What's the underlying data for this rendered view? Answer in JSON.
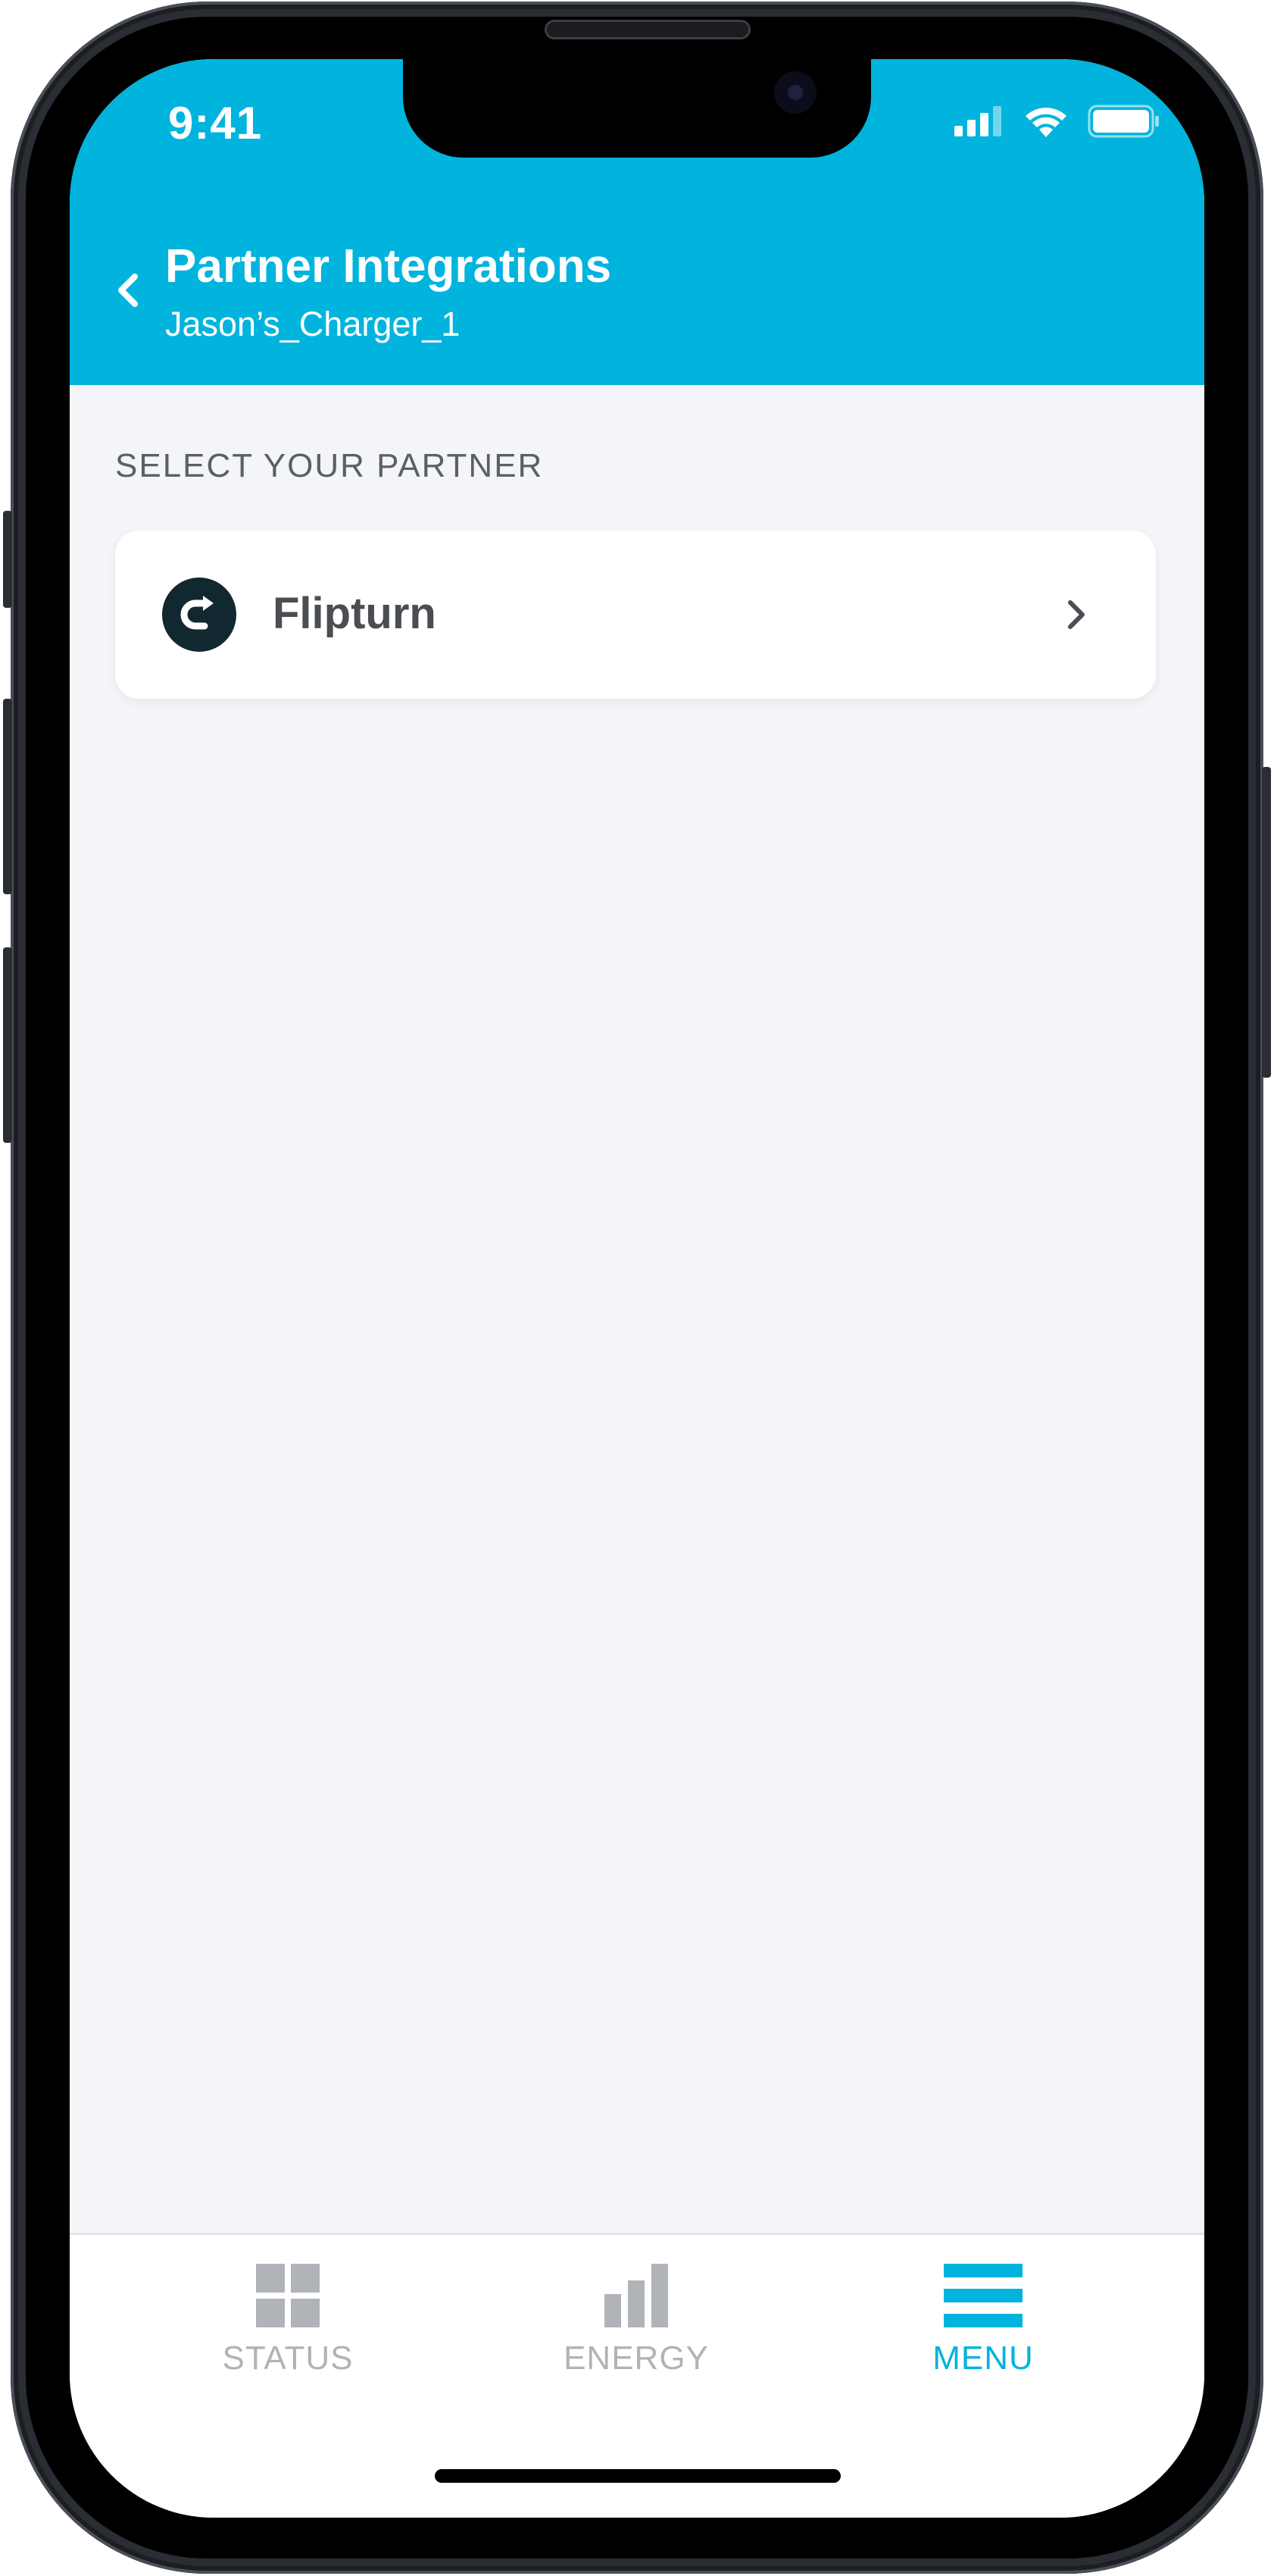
{
  "status_bar": {
    "time": "9:41"
  },
  "header": {
    "title": "Partner Integrations",
    "subtitle": "Jason’s_Charger_1"
  },
  "section": {
    "label": "SELECT YOUR PARTNER"
  },
  "partners": [
    {
      "name": "Flipturn",
      "icon": "flipturn-logo-icon"
    }
  ],
  "tabbar": {
    "tabs": [
      {
        "label": "STATUS",
        "icon": "grid-icon",
        "active": false
      },
      {
        "label": "ENERGY",
        "icon": "bar-chart-icon",
        "active": false
      },
      {
        "label": "MENU",
        "icon": "hamburger-menu-icon",
        "active": true
      }
    ]
  },
  "colors": {
    "brand": "#00b4dd",
    "background": "#f4f5f9",
    "tab_inactive": "#b0b3b8",
    "logo_dark": "#122830"
  }
}
